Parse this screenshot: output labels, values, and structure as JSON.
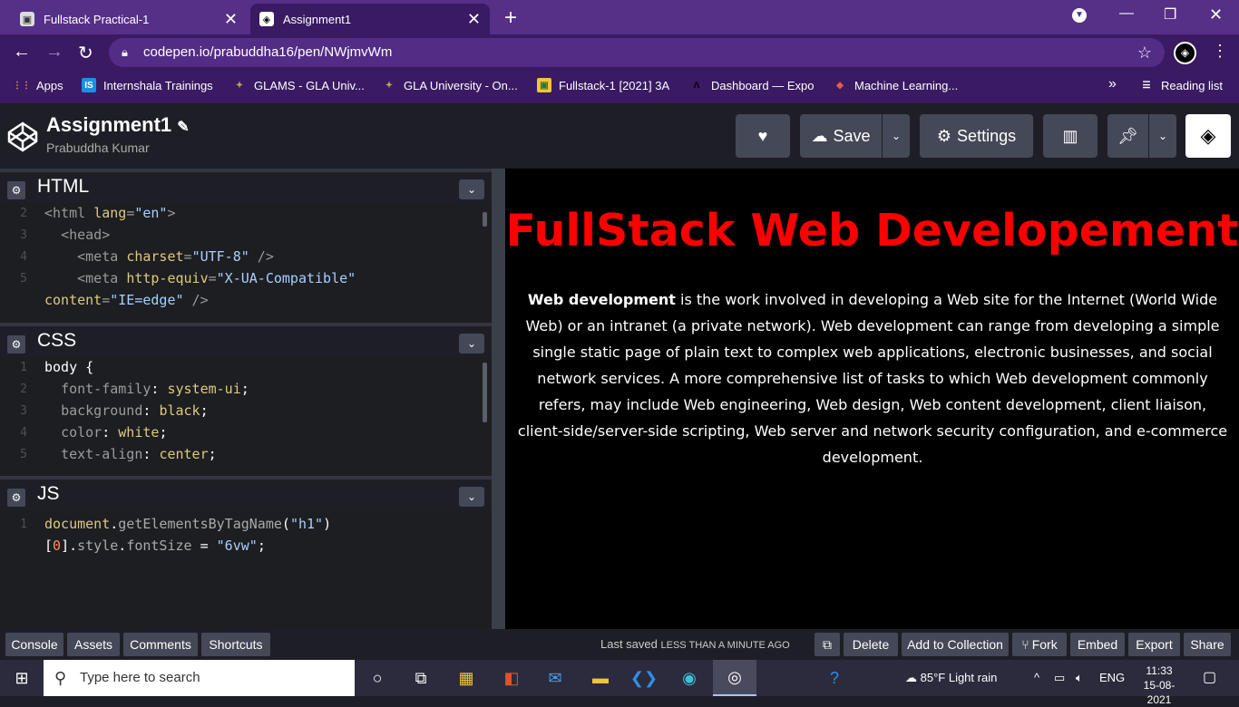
{
  "browser": {
    "tabs": [
      {
        "title": "Fullstack Practical-1",
        "icon": "video-icon"
      },
      {
        "title": "Assignment1",
        "icon": "codepen-icon"
      }
    ],
    "url": "codepen.io/prabuddha16/pen/NWjmvWm",
    "bookmarks": [
      {
        "label": "Apps",
        "color": "#e5a23a",
        "glyph": "⋮⋮"
      },
      {
        "label": "Internshala Trainings",
        "color": "#1e8fe1",
        "glyph": "IS"
      },
      {
        "label": "GLAMS - GLA Univ...",
        "color": "#8a7a3a",
        "glyph": "✦"
      },
      {
        "label": "GLA University - On...",
        "color": "#8a7a3a",
        "glyph": "✦"
      },
      {
        "label": "Fullstack-1 [2021] 3A",
        "color": "#f2c33c",
        "glyph": "▣"
      },
      {
        "label": "Dashboard — Expo",
        "color": "#000000",
        "glyph": "Λ"
      },
      {
        "label": "Machine Learning...",
        "color": "#e85b4a",
        "glyph": "◆"
      }
    ],
    "more": "»",
    "reading_list": "Reading list"
  },
  "codepen": {
    "title": "Assignment1",
    "author": "Prabuddha Kumar",
    "save_label": "Save",
    "settings_label": "Settings"
  },
  "editors": {
    "html": {
      "name": "HTML",
      "lines": [
        {
          "n": "2",
          "html": "<span class='t-tag'>&lt;html </span><span class='t-attr'>lang</span><span class='t-tag'>=</span><span class='t-str'>\"en\"</span><span class='t-tag'>&gt;</span>"
        },
        {
          "n": "3",
          "html": "  <span class='t-tag'>&lt;head&gt;</span>"
        },
        {
          "n": "4",
          "html": "    <span class='t-tag'>&lt;meta </span><span class='t-attr'>charset</span><span class='t-tag'>=</span><span class='t-str'>\"UTF-8\"</span><span class='t-tag'> /&gt;</span>"
        },
        {
          "n": "5",
          "html": "    <span class='t-tag'>&lt;meta </span><span class='t-attr'>http-equiv</span><span class='t-tag'>=</span><span class='t-str'>\"X-UA-Compatible\"</span>"
        },
        {
          "n": "",
          "html": "<span class='t-attr'>content</span><span class='t-tag'>=</span><span class='t-str'>\"IE=edge\"</span><span class='t-tag'> /&gt;</span>"
        }
      ]
    },
    "css": {
      "name": "CSS",
      "lines": [
        {
          "n": "1",
          "html": "<span class='t-w'>body {</span>"
        },
        {
          "n": "2",
          "html": "  <span class='t-prop'>font-family</span><span class='t-w'>: </span><span class='t-val'>system-ui</span><span class='t-w'>;</span>"
        },
        {
          "n": "3",
          "html": "  <span class='t-prop'>background</span><span class='t-w'>: </span><span class='t-val'>black</span><span class='t-w'>;</span>"
        },
        {
          "n": "4",
          "html": "  <span class='t-prop'>color</span><span class='t-w'>: </span><span class='t-val'>white</span><span class='t-w'>;</span>"
        },
        {
          "n": "5",
          "html": "  <span class='t-prop'>text-align</span><span class='t-w'>: </span><span class='t-val'>center</span><span class='t-w'>;</span>"
        }
      ]
    },
    "js": {
      "name": "JS",
      "lines": [
        {
          "n": "1",
          "html": "<span class='t-val'>document</span><span class='t-w'>.</span><span class='t-fn'>getElementsByTagName</span><span class='t-w'>(</span><span class='t-str'>\"h1\"</span><span class='t-w'>)</span>"
        },
        {
          "n": "",
          "html": "<span class='t-w'>[</span><span class='t-num'>0</span><span class='t-w'>].</span><span class='t-fn'>style</span><span class='t-w'>.</span><span class='t-fn'>fontSize</span><span class='t-w'> = </span><span class='t-str'>\"6vw\"</span><span class='t-w'>;</span>"
        }
      ]
    }
  },
  "preview": {
    "heading": "FullStack Web Developement",
    "bold": "Web development",
    "text": " is the work involved in developing a Web site for the Internet (World Wide Web) or an intranet (a private network). Web development can range from developing a simple single static page of plain text to complex web applications, electronic businesses, and social network services. A more comprehensive list of tasks to which Web development commonly refers, may include Web engineering, Web design, Web content development, client liaison, client-side/server-side scripting, Web server and network security configuration, and e-commerce development."
  },
  "footer": {
    "console": "Console",
    "assets": "Assets",
    "comments": "Comments",
    "shortcuts": "Shortcuts",
    "saved_prefix": "Last saved ",
    "saved_when": "LESS THAN A MINUTE AGO",
    "delete": "Delete",
    "add_to_collection": "Add to Collection",
    "fork": "Fork",
    "embed": "Embed",
    "export": "Export",
    "share": "Share"
  },
  "taskbar": {
    "search_placeholder": "Type here to search",
    "weather": "85°F  Light rain",
    "lang": "ENG",
    "time": "11:33",
    "date": "15-08-2021"
  }
}
